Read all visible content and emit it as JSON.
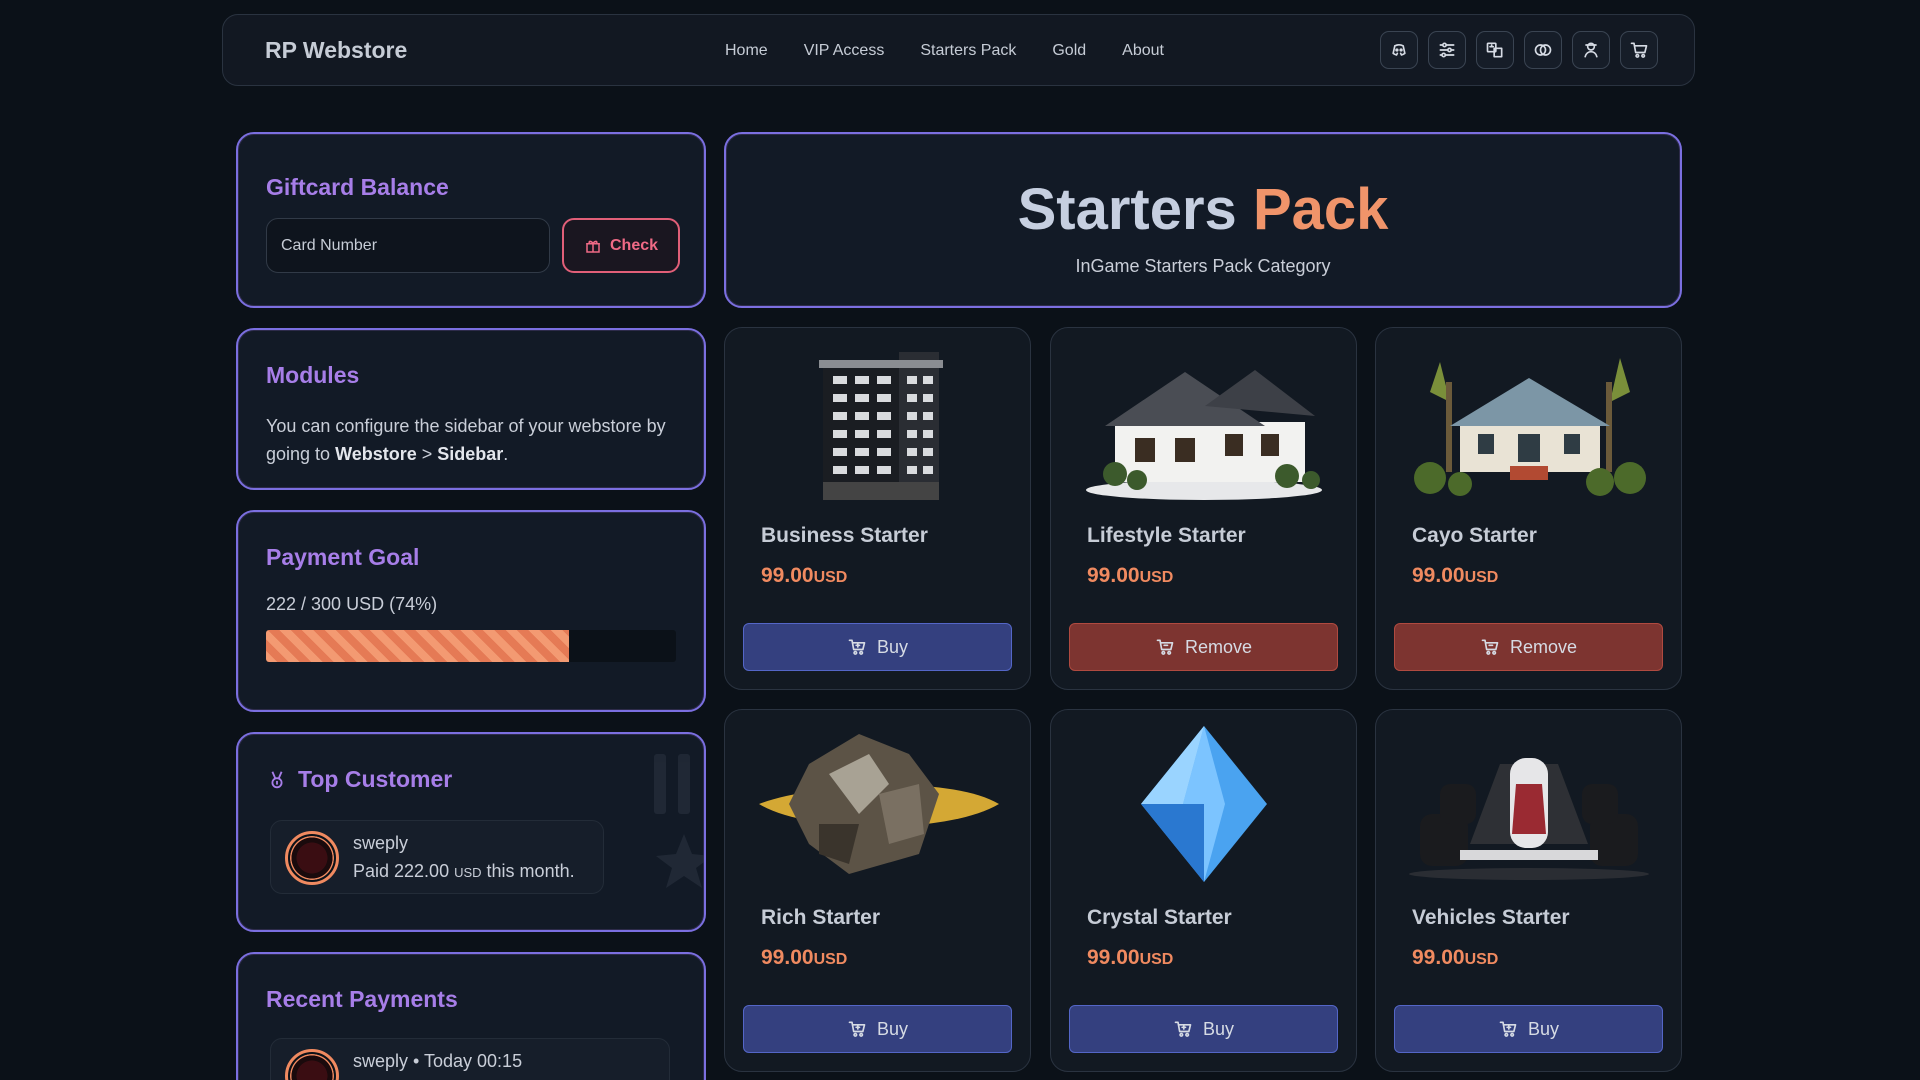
{
  "nav": {
    "brand": "RP Webstore",
    "links": [
      "Home",
      "VIP Access",
      "Starters Pack",
      "Gold",
      "About"
    ],
    "icons": [
      "discord-icon",
      "sliders-icon",
      "translate-icon",
      "currency-icon",
      "user-icon",
      "cart-icon"
    ]
  },
  "giftcard": {
    "title": "Giftcard Balance",
    "placeholder": "Card Number",
    "button": "Check"
  },
  "modules": {
    "title": "Modules",
    "text_before": "You can configure the sidebar of your webstore by going to ",
    "bold1": "Webstore",
    "sep": " > ",
    "bold2": "Sidebar",
    "end": "."
  },
  "payment_goal": {
    "title": "Payment Goal",
    "text": "222 / 300 USD (74%)",
    "progress": 0.74
  },
  "top_customer": {
    "title": "Top Customer",
    "name": "sweply",
    "paid_prefix": "Paid 222.00 ",
    "currency": "USD",
    "paid_suffix": " this month."
  },
  "recent_payments": {
    "title": "Recent Payments",
    "entry": "sweply • Today 00:15"
  },
  "hero": {
    "title_part1": "Starters",
    "title_part2": "Pack",
    "subtitle": "InGame Starters  Pack Category"
  },
  "products": [
    {
      "name": "Business Starter",
      "price": "99.00",
      "currency": "USD",
      "button": "Buy",
      "state": "buy"
    },
    {
      "name": "Lifestyle Starter",
      "price": "99.00",
      "currency": "USD",
      "button": "Remove",
      "state": "remove"
    },
    {
      "name": "Cayo Starter",
      "price": "99.00",
      "currency": "USD",
      "button": "Remove",
      "state": "remove"
    },
    {
      "name": "Rich Starter",
      "price": "99.00",
      "currency": "USD",
      "button": "Buy",
      "state": "buy"
    },
    {
      "name": "Crystal Starter",
      "price": "99.00",
      "currency": "USD",
      "button": "Buy",
      "state": "buy"
    },
    {
      "name": "Vehicles Starter",
      "price": "99.00",
      "currency": "USD",
      "button": "Buy",
      "state": "buy"
    }
  ],
  "colors": {
    "accent_purple": "#a77ee8",
    "accent_orange": "#f08a60",
    "buy_button": "#34407f",
    "remove_button": "#7d3430"
  }
}
